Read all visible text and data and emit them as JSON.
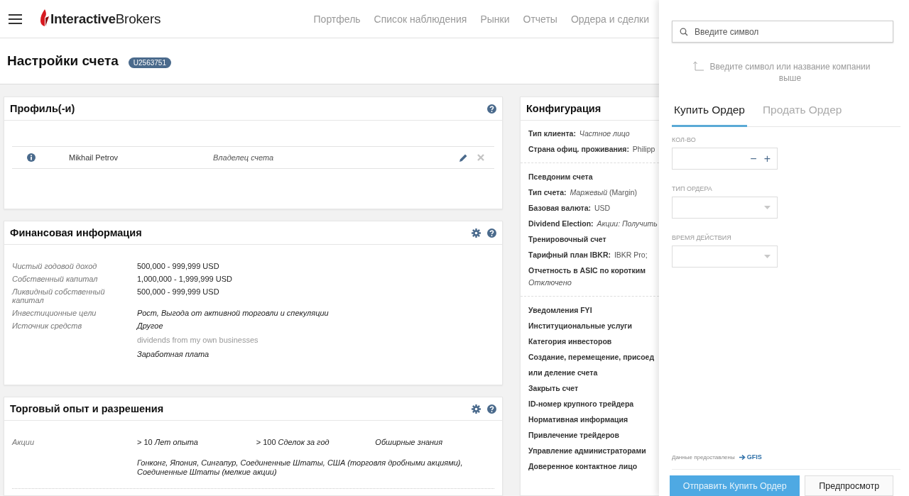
{
  "header": {
    "logo": "**Interactive**Brokers",
    "nav": [
      "Портфель",
      "Список наблюдения",
      "Рынки",
      "Отчеты",
      "Ордера и сделки"
    ]
  },
  "page": {
    "title": "Настройки счета",
    "account_badge": "U2563751"
  },
  "profile": {
    "title": "Профиль(-и)",
    "rows": [
      {
        "name": "Mikhail Petrov",
        "role": "Владелец счета"
      }
    ]
  },
  "financial": {
    "title": "Финансовая информация",
    "rows": [
      {
        "label": "Чистый годовой доход",
        "values": [
          {
            "text": "500,000 - 999,999 USD",
            "kind": "plain"
          }
        ]
      },
      {
        "label": "Собственный капитал",
        "values": [
          {
            "text": "1,000,000 - 1,999,999 USD",
            "kind": "plain"
          }
        ]
      },
      {
        "label": "Ликвидный собственный капитал",
        "values": [
          {
            "text": "500,000 - 999,999 USD",
            "kind": "plain"
          }
        ]
      },
      {
        "label": "Инвестиционные цели",
        "values": [
          {
            "text": "Рост, Выгода от активной торговли и спекуляции",
            "kind": "italic"
          }
        ]
      },
      {
        "label": "Источник средств",
        "values": [
          {
            "text": "Другое",
            "kind": "italic"
          },
          {
            "text": "dividends from my own businesses",
            "kind": "note"
          },
          {
            "text": "Заработная плата",
            "kind": "italic"
          }
        ]
      }
    ]
  },
  "trading": {
    "title": "Торговый опыт и разрешения",
    "rows": [
      {
        "label": "Акции",
        "cells": [
          "> 10 *Лет опыта*",
          "> 100 *Сделок за год*",
          "*Обширные знания*"
        ],
        "markets": "Гонконг, Япония, Сингапур, Соединенные Штаты, США (торговля дробными акциями), Соединенные Штаты (мелкие акции)"
      }
    ]
  },
  "configuration": {
    "title": "Конфигурация",
    "groups": [
      [
        {
          "label": "Тип клиента:",
          "value": "*Частное лицо*"
        },
        {
          "label": "Страна офиц. проживания:",
          "value": "Philipp"
        }
      ],
      [
        {
          "label": "Псевдоним счета"
        },
        {
          "label": "Тип счета:",
          "value": "*Маржевый* (Margin)"
        },
        {
          "label": "Базовая валюта:",
          "value": "USD"
        },
        {
          "label": "Dividend Election:",
          "value": "*Акции: Получить*"
        },
        {
          "label": "Тренировочный счет"
        },
        {
          "label": "Тарифный план IBKR:",
          "value": "IBKR Pro;"
        },
        {
          "label": "Отчетность в ASIC по коротким",
          "below": "Отключено"
        }
      ],
      [
        {
          "label": "Уведомления FYI"
        },
        {
          "label": "Институциональные услуги"
        },
        {
          "label": "Категория инвесторов"
        },
        {
          "label": "Создание, перемещение, присоед"
        },
        {
          "label": "или деление счета"
        },
        {
          "label": "Закрыть счет"
        },
        {
          "label": "ID-номер крупного трейдера"
        },
        {
          "label": "Нормативная информация"
        },
        {
          "label": "Привлечение трейдеров"
        },
        {
          "label": "Управление администраторами"
        },
        {
          "label": "Доверенное контактное лицо"
        }
      ]
    ]
  },
  "order_panel": {
    "search": {
      "placeholder": "Введите символ"
    },
    "hint": "Введите символ или название компании выше",
    "tabs": [
      {
        "label": "Купить Ордер",
        "selected": true
      },
      {
        "label": "Продать Ордер",
        "selected": false
      }
    ],
    "fields": [
      {
        "label": "КОЛ-ВО",
        "kind": "stepper",
        "minus": "−",
        "plus": "+"
      },
      {
        "label": "ТИП ОРДЕРА",
        "kind": "select"
      },
      {
        "label": "ВРЕМЯ ДЕЙСТВИЯ",
        "kind": "select"
      }
    ],
    "credit": "Данные предоставлены",
    "provider": "GFIS",
    "buttons": [
      {
        "label": "Отправить Купить Ордер",
        "kind": "primary"
      },
      {
        "label": "Предпросмотр",
        "kind": "secondary"
      }
    ]
  }
}
